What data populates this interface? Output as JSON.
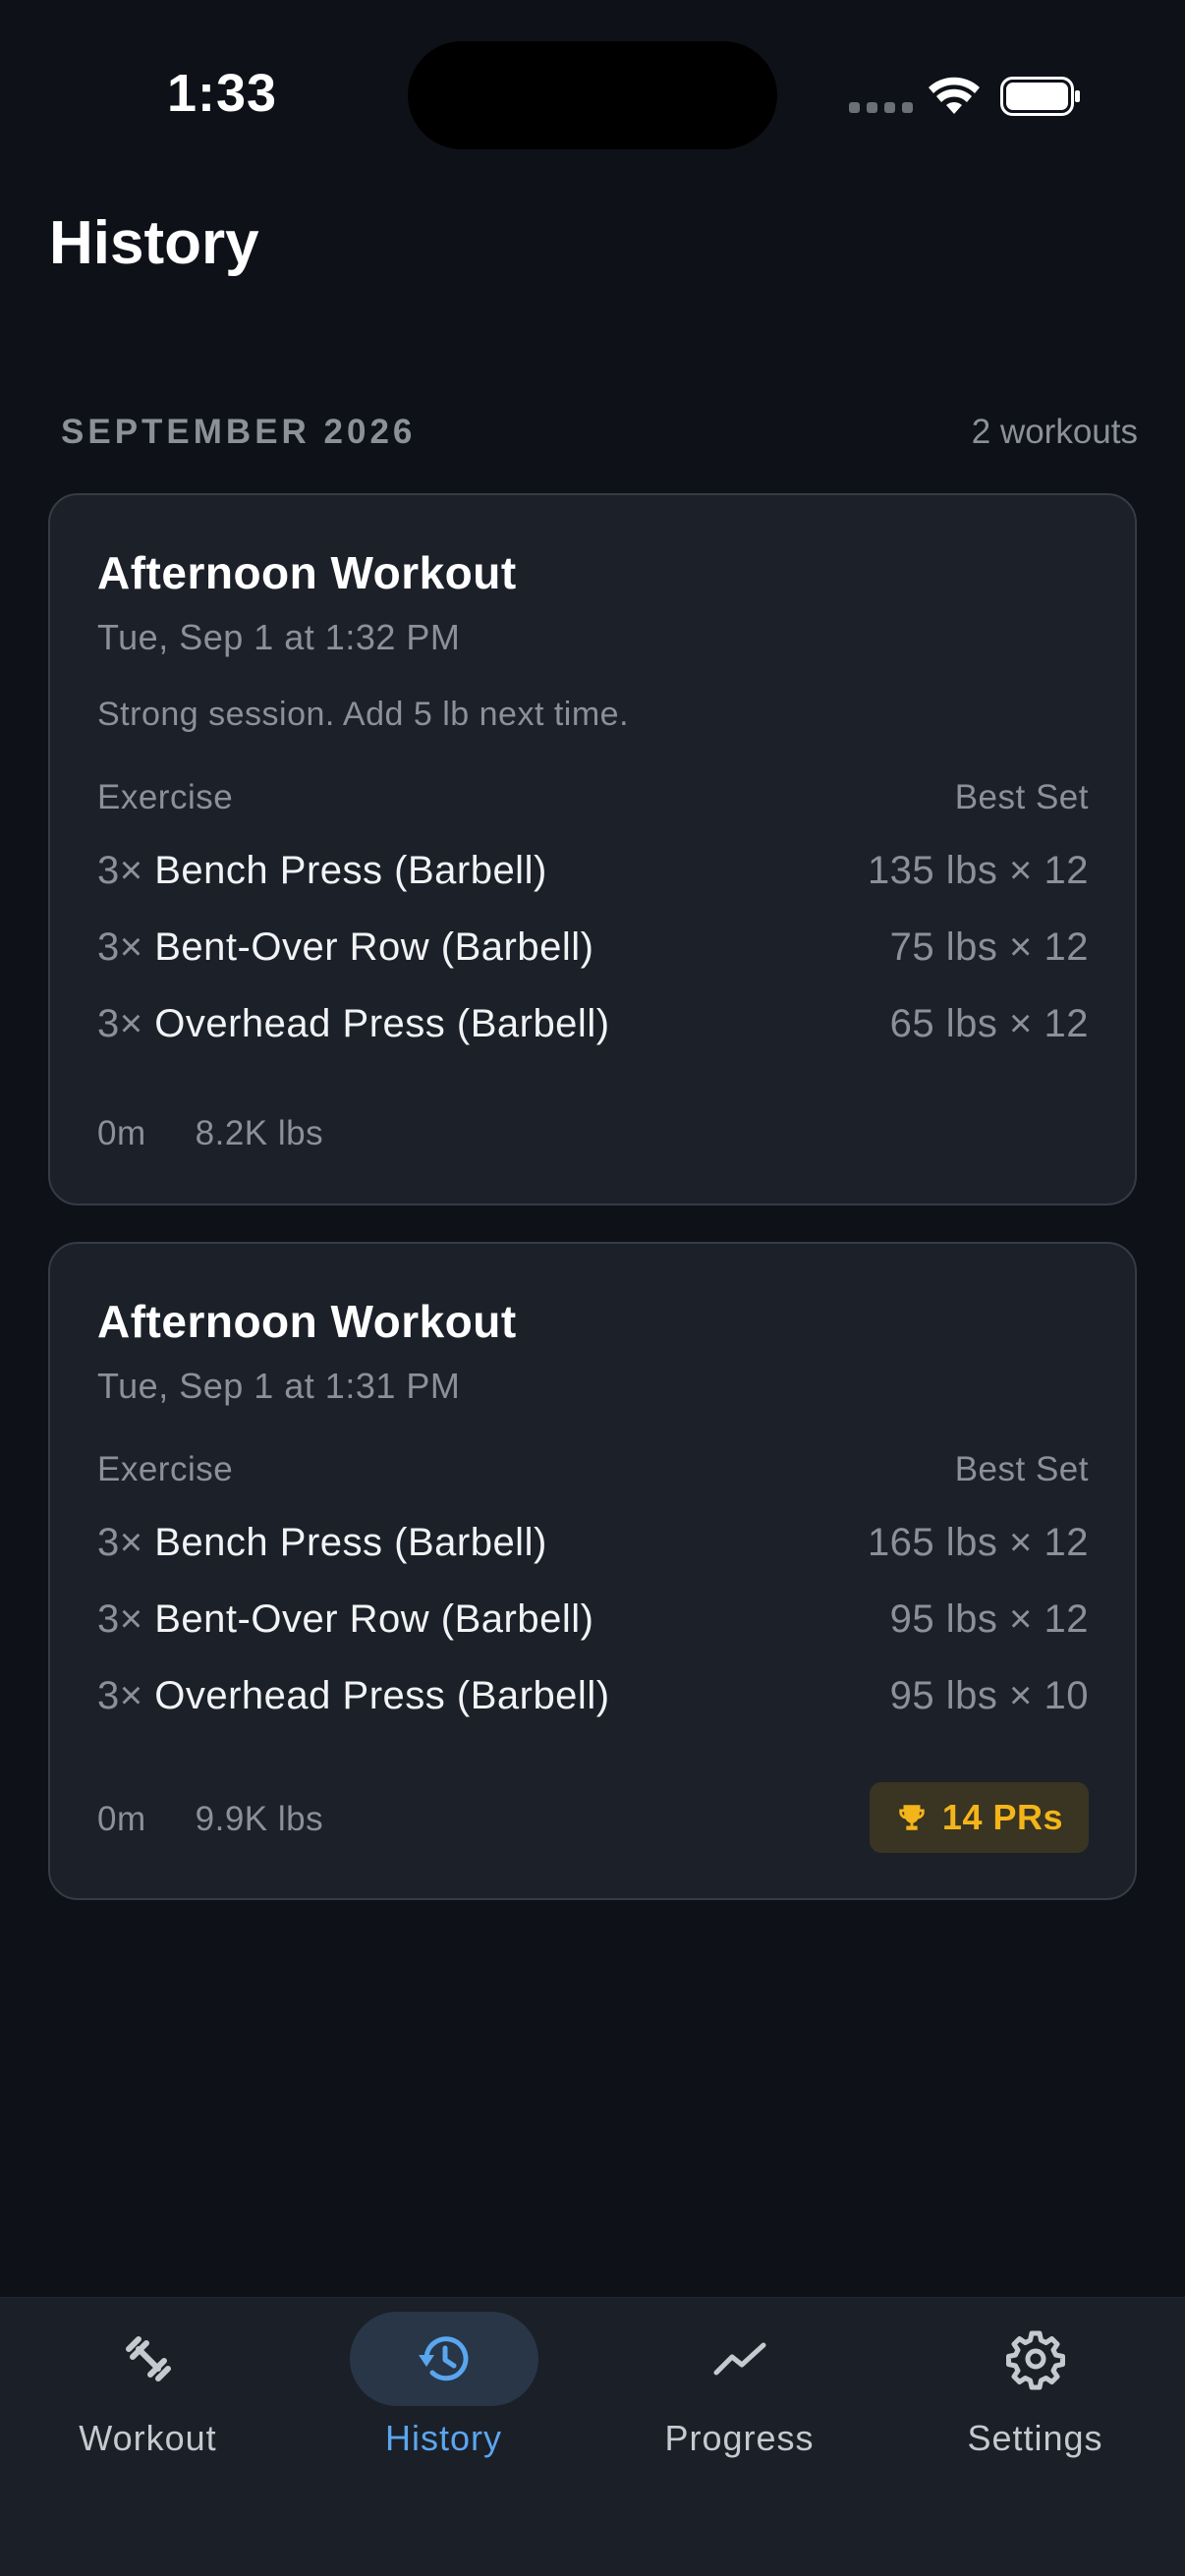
{
  "status_bar": {
    "time": "1:33"
  },
  "page": {
    "title": "History"
  },
  "section": {
    "month": "SEPTEMBER 2026",
    "count": "2 workouts"
  },
  "columns": {
    "exercise": "Exercise",
    "best_set": "Best Set"
  },
  "workouts": [
    {
      "title": "Afternoon Workout",
      "date": "Tue, Sep 1 at 1:32 PM",
      "note": "Strong session. Add 5 lb next time.",
      "exercises": [
        {
          "sets": "3×",
          "name": "Bench Press (Barbell)",
          "best": "135 lbs × 12"
        },
        {
          "sets": "3×",
          "name": "Bent-Over Row (Barbell)",
          "best": "75 lbs × 12"
        },
        {
          "sets": "3×",
          "name": "Overhead Press (Barbell)",
          "best": "65 lbs × 12"
        }
      ],
      "duration": "0m",
      "volume": "8.2K lbs"
    },
    {
      "title": "Afternoon Workout",
      "date": "Tue, Sep 1 at 1:31 PM",
      "exercises": [
        {
          "sets": "3×",
          "name": "Bench Press (Barbell)",
          "best": "165 lbs × 12"
        },
        {
          "sets": "3×",
          "name": "Bent-Over Row (Barbell)",
          "best": "95 lbs × 12"
        },
        {
          "sets": "3×",
          "name": "Overhead Press (Barbell)",
          "best": "95 lbs × 10"
        }
      ],
      "duration": "0m",
      "volume": "9.9K lbs",
      "prs": "14 PRs"
    }
  ],
  "tabs": [
    {
      "label": "Workout",
      "icon": "dumbbell-icon"
    },
    {
      "label": "History",
      "icon": "history-icon",
      "active": true
    },
    {
      "label": "Progress",
      "icon": "trend-icon"
    },
    {
      "label": "Settings",
      "icon": "gear-icon"
    }
  ],
  "colors": {
    "background": "#0e1118",
    "card": "#1c2029",
    "accent": "#5aa6ee",
    "pr": "#f3b519"
  }
}
